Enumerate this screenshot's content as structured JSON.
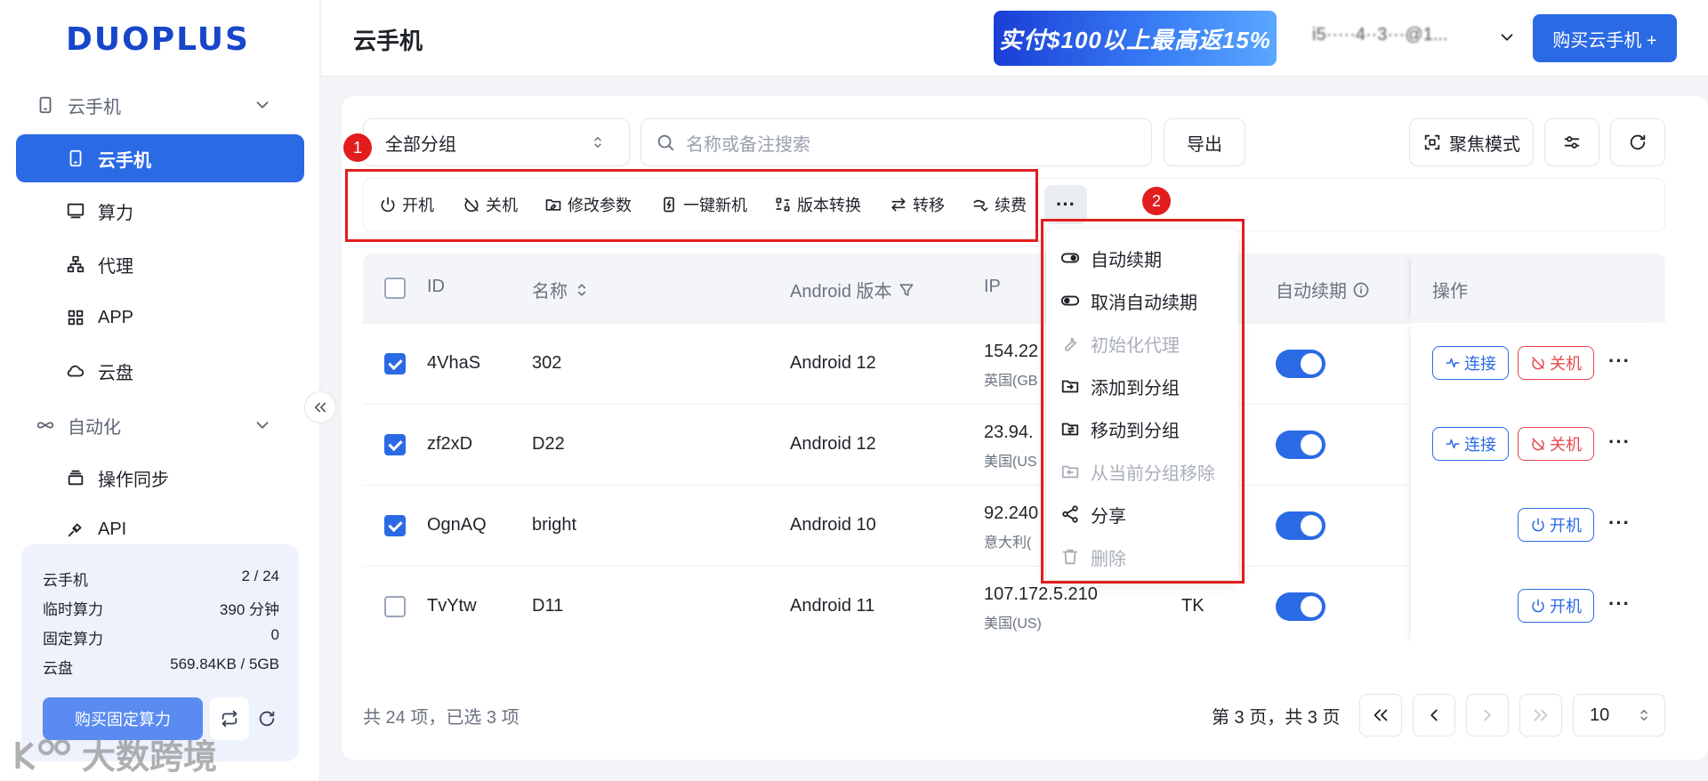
{
  "app": {
    "logo": "DUOPLUS",
    "page_title": "云手机"
  },
  "sidebar": {
    "groups": [
      {
        "label": "云手机",
        "icon": "phone-icon",
        "items": [
          {
            "label": "云手机",
            "icon": "phone-icon",
            "active": true
          },
          {
            "label": "算力",
            "icon": "monitor-icon"
          },
          {
            "label": "代理",
            "icon": "network-icon"
          },
          {
            "label": "APP",
            "icon": "grid-icon"
          },
          {
            "label": "云盘",
            "icon": "cloud-icon"
          }
        ]
      },
      {
        "label": "自动化",
        "icon": "infinity-icon",
        "items": [
          {
            "label": "操作同步",
            "icon": "layers-icon"
          },
          {
            "label": "API",
            "icon": "plug-icon"
          }
        ]
      }
    ],
    "stats": [
      {
        "label": "云手机",
        "value": "2 / 24"
      },
      {
        "label": "临时算力",
        "value": "390 分钟"
      },
      {
        "label": "固定算力",
        "value": "0"
      },
      {
        "label": "云盘",
        "value": "569.84KB / 5GB"
      }
    ],
    "buy_fixed_label": "购买固定算力"
  },
  "header": {
    "promo": "实付$100以上最高返15%",
    "account": "i5·····4··3···@1...",
    "buy_label": "购买云手机 +"
  },
  "filters": {
    "group_select": "全部分组",
    "search_placeholder": "名称或备注搜索",
    "export_label": "导出",
    "focus_label": "聚焦模式"
  },
  "toolbar": {
    "items": [
      {
        "label": "开机",
        "icon": "power-icon"
      },
      {
        "label": "关机",
        "icon": "power-off-icon"
      },
      {
        "label": "修改参数",
        "icon": "edit-folder-icon"
      },
      {
        "label": "一键新机",
        "icon": "new-phone-icon"
      },
      {
        "label": "版本转换",
        "icon": "convert-icon"
      },
      {
        "label": "转移",
        "icon": "transfer-icon"
      },
      {
        "label": "续费",
        "icon": "renew-icon"
      }
    ],
    "more_label": "···"
  },
  "annotations": {
    "box1": "1",
    "box2": "2"
  },
  "table": {
    "columns": {
      "id": "ID",
      "name": "名称",
      "android": "Android 版本",
      "ip": "IP",
      "auto_renew": "自动续期",
      "actions": "操作"
    },
    "rows": [
      {
        "id": "4VhaS",
        "name": "302",
        "android": "Android 12",
        "ip": "154.22",
        "region": "英国(GB",
        "checked": true,
        "renew": true,
        "action": "关机"
      },
      {
        "id": "zf2xD",
        "name": "D22",
        "android": "Android 12",
        "ip": "23.94.",
        "region": "美国(US",
        "checked": true,
        "renew": true,
        "action": "关机"
      },
      {
        "id": "OgnAQ",
        "name": "bright",
        "android": "Android 10",
        "ip": "92.240",
        "region": "意大利(",
        "checked": true,
        "renew": true,
        "action": "开机"
      },
      {
        "id": "TvYtw",
        "name": "D11",
        "android": "Android 11",
        "ip": "107.172.5.210",
        "region": "美国(US)",
        "extra": "TK",
        "checked": false,
        "renew": true,
        "action": "开机"
      }
    ],
    "connect_label": "连接",
    "shutdown_label": "关机",
    "boot_label": "开机"
  },
  "more_menu": [
    {
      "label": "自动续期",
      "icon": "toggle-on-icon",
      "disabled": false
    },
    {
      "label": "取消自动续期",
      "icon": "toggle-off-icon",
      "disabled": false
    },
    {
      "label": "初始化代理",
      "icon": "wrench-icon",
      "disabled": true
    },
    {
      "label": "添加到分组",
      "icon": "folder-add-icon",
      "disabled": false
    },
    {
      "label": "移动到分组",
      "icon": "folder-move-icon",
      "disabled": false
    },
    {
      "label": "从当前分组移除",
      "icon": "folder-remove-icon",
      "disabled": true
    },
    {
      "label": "分享",
      "icon": "share-icon",
      "disabled": false
    },
    {
      "label": "删除",
      "icon": "trash-icon",
      "disabled": true
    }
  ],
  "footer": {
    "total": "共 24 项，已选 3 项",
    "page_info": "第 3 页，共 3 页",
    "page_size": "10"
  },
  "watermark": "大数跨境",
  "colors": {
    "primary": "#2b6ae5",
    "danger": "#e5484d",
    "annotation": "#e21d1d"
  }
}
